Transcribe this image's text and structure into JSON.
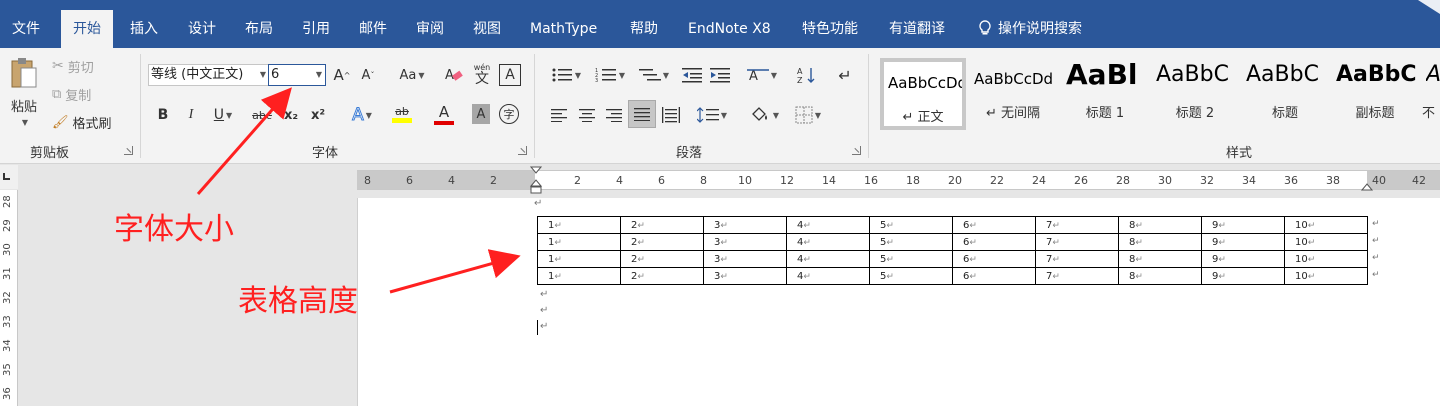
{
  "tabs": [
    "文件",
    "开始",
    "插入",
    "设计",
    "布局",
    "引用",
    "邮件",
    "审阅",
    "视图",
    "MathType",
    "帮助",
    "EndNote X8",
    "特色功能",
    "有道翻译",
    "操作说明搜索"
  ],
  "active_tab": "开始",
  "colors": {
    "brand": "#2b579a",
    "annotation": "#ff2020",
    "highlight": "#ffff00",
    "font_color": "#e00000"
  },
  "clipboard": {
    "paste": "粘贴",
    "cut": "剪切",
    "copy": "复制",
    "format_painter": "格式刷",
    "label": "剪贴板"
  },
  "font": {
    "font_name": "等线 (中文正文)",
    "font_size": "6",
    "label": "字体",
    "bold": "B",
    "italic": "I",
    "underline": "U",
    "strikethrough": "abc",
    "subscript": "x₂",
    "superscript": "x²",
    "change_case": "Aa",
    "grow": "A",
    "shrink": "A",
    "phonetic": "wén",
    "phonetic_char": "文",
    "border_char": "A",
    "text_effect": "A",
    "highlight": "ab",
    "font_color": "A",
    "shading": "A",
    "enclose": "字"
  },
  "paragraph": {
    "label": "段落"
  },
  "styles": {
    "label": "样式",
    "items": [
      {
        "sample": "AaBbCcDd",
        "name": "↵ 正文",
        "selected": true
      },
      {
        "sample": "AaBbCcDd",
        "name": "↵ 无间隔",
        "selected": false
      },
      {
        "sample": "AaBl",
        "name": "标题 1",
        "selected": false
      },
      {
        "sample": "AaBbC",
        "name": "标题 2",
        "selected": false
      },
      {
        "sample": "AaBbC",
        "name": "标题",
        "selected": false
      },
      {
        "sample": "AaBbC",
        "name": "副标题",
        "selected": false
      },
      {
        "sample": "A",
        "name": "不",
        "selected": false
      }
    ]
  },
  "ruler": {
    "ticks": [
      "8",
      "6",
      "4",
      "2",
      "2",
      "4",
      "6",
      "8",
      "10",
      "12",
      "14",
      "16",
      "18",
      "20",
      "22",
      "24",
      "26",
      "28",
      "30",
      "32",
      "34",
      "36",
      "38",
      "40",
      "42"
    ]
  },
  "vruler": {
    "ticks": [
      "28",
      "29",
      "30",
      "31",
      "32",
      "33",
      "34",
      "35",
      "36"
    ]
  },
  "table": {
    "rows": [
      [
        "1",
        "2",
        "3",
        "4",
        "5",
        "6",
        "7",
        "8",
        "9",
        "10"
      ],
      [
        "1",
        "2",
        "3",
        "4",
        "5",
        "6",
        "7",
        "8",
        "9",
        "10"
      ],
      [
        "1",
        "2",
        "3",
        "4",
        "5",
        "6",
        "7",
        "8",
        "9",
        "10"
      ],
      [
        "1",
        "2",
        "3",
        "4",
        "5",
        "6",
        "7",
        "8",
        "9",
        "10"
      ]
    ],
    "cell_mark": "↵",
    "para_mark": "↵"
  },
  "annotations": {
    "font_size_note": "字体大小",
    "table_height_note": "表格高度"
  }
}
